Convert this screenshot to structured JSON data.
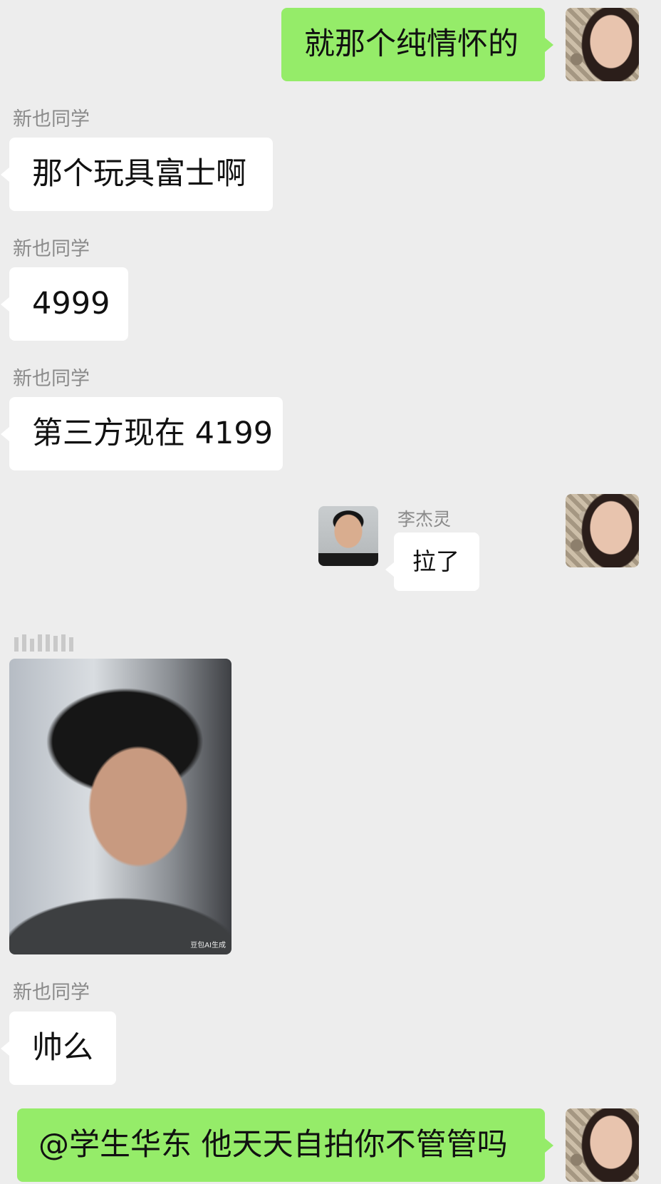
{
  "messages": [
    {
      "side": "right",
      "text": "就那个纯情怀的"
    },
    {
      "side": "left",
      "sender": "新也同学",
      "text": "那个玩具富士啊"
    },
    {
      "side": "left",
      "sender": "新也同学",
      "text": "4999"
    },
    {
      "side": "left",
      "sender": "新也同学",
      "text": "第三方现在 4199"
    },
    {
      "side": "right",
      "type": "card",
      "card_name": "李杰灵",
      "card_text": "拉了"
    },
    {
      "side": "left",
      "type": "image",
      "image_mark": "豆包AI生成"
    },
    {
      "side": "left",
      "sender": "新也同学",
      "text": "帅么"
    },
    {
      "side": "right",
      "text": "@学生华东  他天天自拍你不管管吗"
    }
  ]
}
